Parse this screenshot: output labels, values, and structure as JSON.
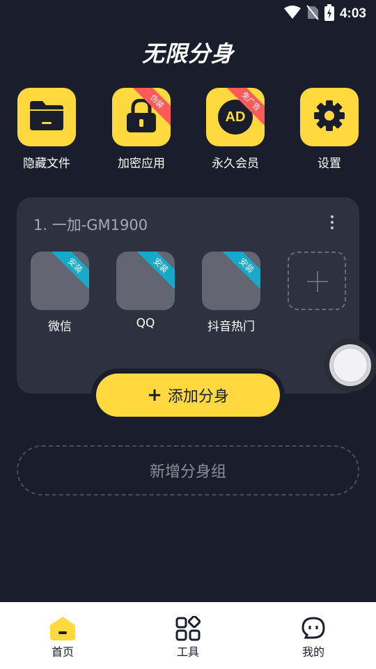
{
  "status_bar": {
    "time": "4:03"
  },
  "app_title": "无限分身",
  "features": [
    {
      "label": "隐藏文件",
      "icon": "folder-icon"
    },
    {
      "label": "加密应用",
      "icon": "lock-icon",
      "ribbon": "伪装"
    },
    {
      "label": "永久会员",
      "icon": "ad-icon",
      "ribbon": "免广告",
      "icon_text": "AD"
    },
    {
      "label": "设置",
      "icon": "gear-icon"
    }
  ],
  "group": {
    "title": "1. 一加-GM1900",
    "clones": [
      {
        "label": "微信",
        "ribbon": "安装"
      },
      {
        "label": "QQ",
        "ribbon": "安装"
      },
      {
        "label": "抖音热门",
        "ribbon": "安装"
      }
    ]
  },
  "add_button": {
    "plus": "+",
    "label": "添加分身"
  },
  "new_group_label": "新增分身组",
  "bottom_nav": [
    {
      "label": "首页",
      "icon": "home-icon"
    },
    {
      "label": "工具",
      "icon": "tools-icon"
    },
    {
      "label": "我的",
      "icon": "profile-icon"
    }
  ],
  "colors": {
    "background": "#1a1d2b",
    "accent": "#ffd93d",
    "card": "#2e3140",
    "ribbon_red": "#ff5a5a",
    "ribbon_teal": "#16a9c9"
  }
}
